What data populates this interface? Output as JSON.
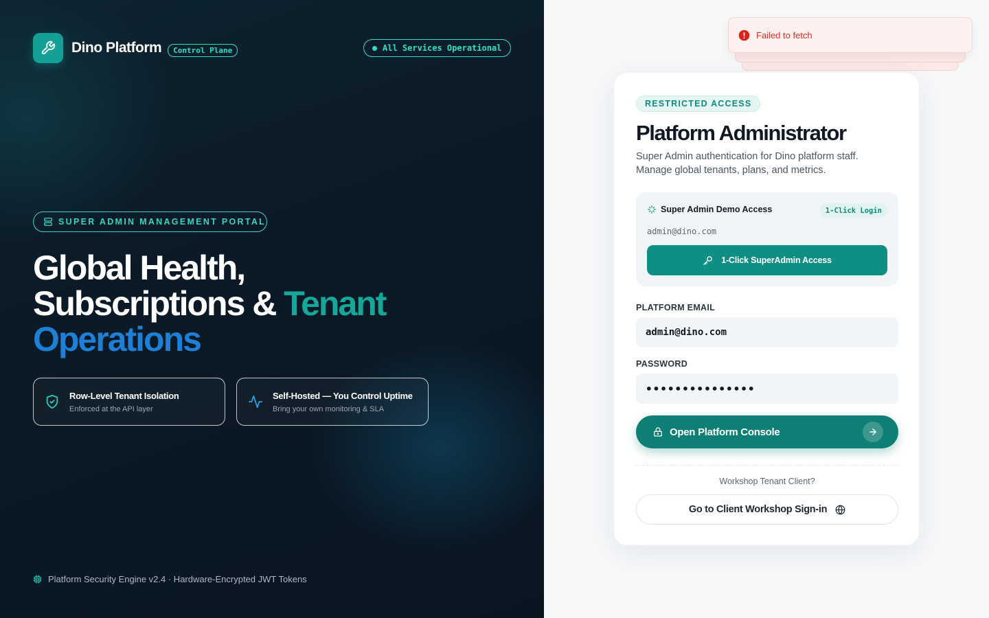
{
  "brand": {
    "name": "Dino Platform",
    "tag": "Control Plane",
    "logo_icon": "wrench-icon"
  },
  "status": {
    "label": "All Services Operational",
    "color": "#2ee0c8"
  },
  "portal_badge": {
    "label": "SUPER ADMIN MANAGEMENT PORTAL",
    "icon": "server-icon"
  },
  "hero": {
    "line1": "Global Health,",
    "line2_white": "Subscriptions & ",
    "line2_teal": "Tenant",
    "line3_blue": "Operations"
  },
  "features": [
    {
      "title": "Row-Level Tenant Isolation",
      "subtitle": "Enforced at the API layer",
      "icon": "shield-check-icon"
    },
    {
      "title": "Self-Hosted — You Control Uptime",
      "subtitle": "Bring your own monitoring & SLA",
      "icon": "activity-icon"
    }
  ],
  "footer_note": {
    "text": "Platform Security Engine v2.4 · Hardware-Encrypted JWT Tokens",
    "icon": "chip-icon"
  },
  "toast": {
    "message": "Failed to fetch",
    "icon": "alert-circle-icon",
    "color": "#d2302a"
  },
  "card": {
    "badge": "RESTRICTED ACCESS",
    "title": "Platform Administrator",
    "description": "Super Admin authentication for Dino platform staff. Manage global tenants, plans, and metrics.",
    "demo": {
      "title": "Super Admin Demo Access",
      "tag": "1-Click Login",
      "email": "admin@dino.com",
      "button": "1-Click SuperAdmin Access"
    },
    "email_label": "PLATFORM EMAIL",
    "email_value": "admin@dino.com",
    "password_label": "PASSWORD",
    "password_value": "•••••••••••••••",
    "primary_button": "Open Platform Console",
    "divider_text": "Workshop Tenant Client?",
    "secondary_button": "Go to Client Workshop Sign-in"
  },
  "colors": {
    "accent": "#0e7f74",
    "teal_text": "#14a89a",
    "blue_text": "#1d7fd6",
    "error": "#d2302a"
  }
}
